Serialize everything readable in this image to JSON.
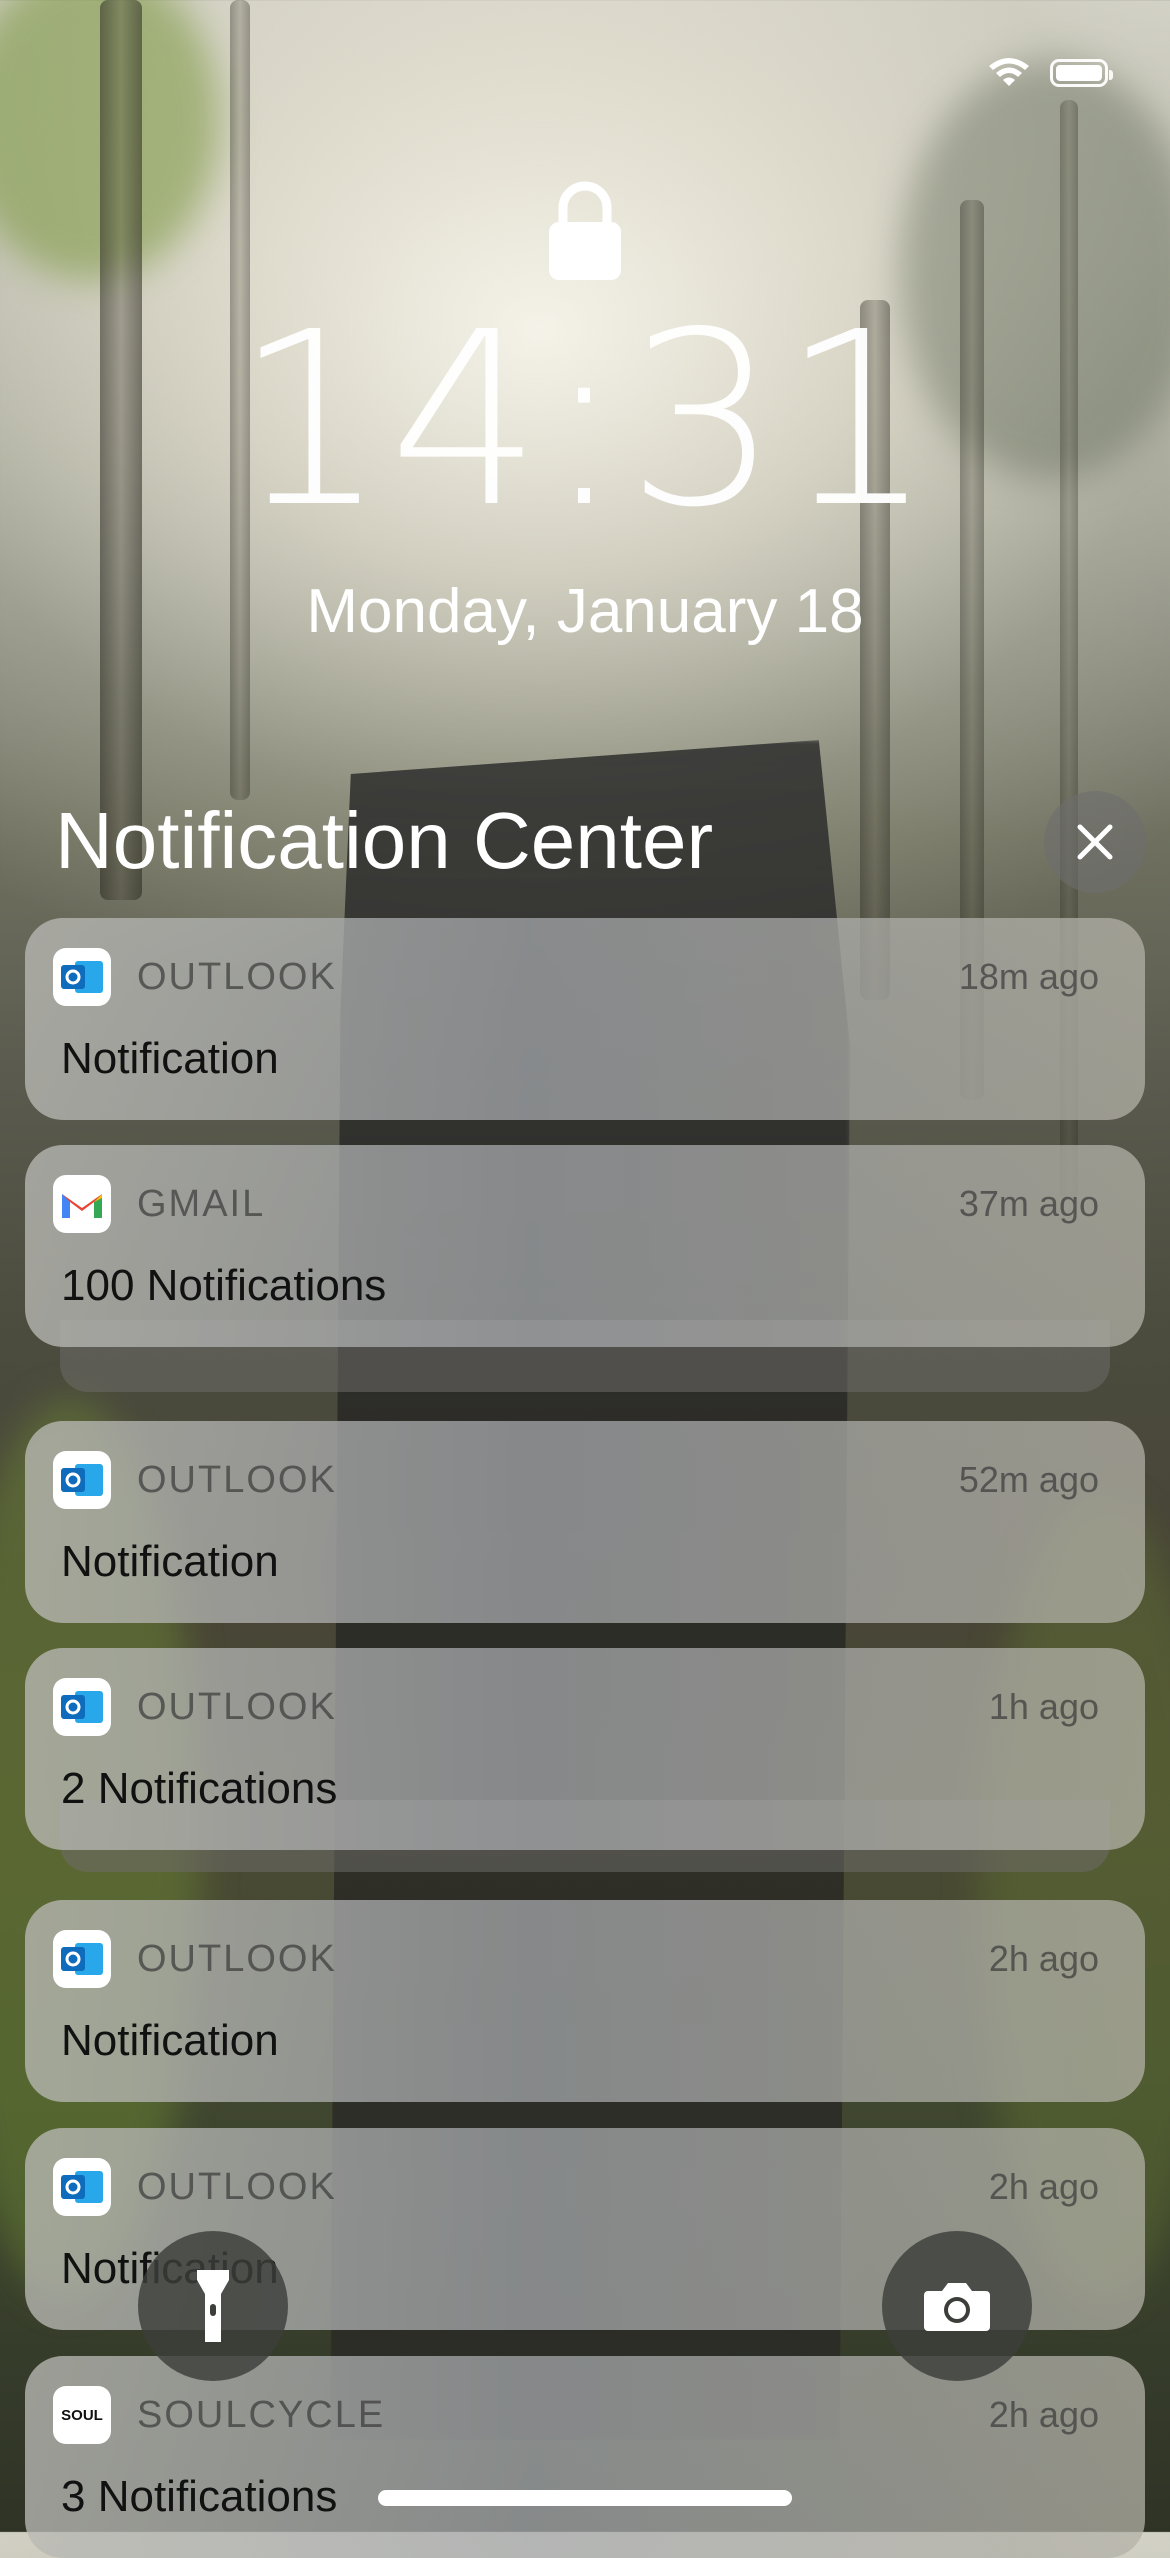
{
  "lock_screen": {
    "time": "14:31",
    "date": "Monday, January 18"
  },
  "notification_center": {
    "title": "Notification Center"
  },
  "notifications": [
    {
      "app": "OUTLOOK",
      "time": "18m ago",
      "body": "Notification",
      "icon": "outlook-icon"
    },
    {
      "app": "GMAIL",
      "time": "37m ago",
      "body": "100 Notifications",
      "icon": "gmail-icon"
    },
    {
      "app": "OUTLOOK",
      "time": "52m ago",
      "body": "Notification",
      "icon": "outlook-icon"
    },
    {
      "app": "OUTLOOK",
      "time": "1h ago",
      "body": "2 Notifications",
      "icon": "outlook-icon"
    },
    {
      "app": "OUTLOOK",
      "time": "2h ago",
      "body": "Notification",
      "icon": "outlook-icon"
    },
    {
      "app": "OUTLOOK",
      "time": "2h ago",
      "body": "Notification",
      "icon": "outlook-icon"
    },
    {
      "app": "SOULCYCLE",
      "time": "2h ago",
      "body": "3 Notifications",
      "icon": "soulcycle-icon"
    }
  ],
  "soulcycle_logo_text": "SOUL",
  "colors": {
    "outlook_blue": "#0F6CBD",
    "gmail_red": "#EA4335",
    "soulcycle_yellow": "#F4C20D"
  }
}
